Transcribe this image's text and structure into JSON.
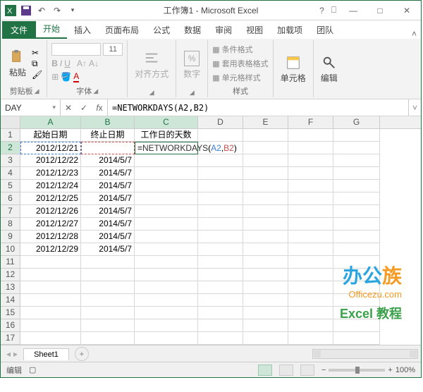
{
  "title": "工作簿1 - Microsoft Excel",
  "tabs": {
    "file": "文件",
    "home": "开始",
    "insert": "插入",
    "layout": "页面布局",
    "formulas": "公式",
    "data": "数据",
    "review": "审阅",
    "view": "视图",
    "addins": "加载项",
    "team": "团队"
  },
  "ribbon": {
    "clipboard": {
      "paste": "粘贴",
      "label": "剪贴板"
    },
    "font": {
      "label": "字体",
      "size": "11"
    },
    "align": {
      "label": "对齐方式"
    },
    "number": {
      "label": "数字",
      "percent": "%"
    },
    "styles": {
      "cond": "条件格式",
      "table": "套用表格格式",
      "cell": "单元格样式",
      "label": "样式"
    },
    "cells": {
      "label": "单元格"
    },
    "editing": {
      "label": "编辑"
    }
  },
  "formula_bar": {
    "name_box": "DAY",
    "formula": "=NETWORKDAYS(A2,B2)",
    "fn": "NETWORKDAYS",
    "a": "A2",
    "b": "B2"
  },
  "columns": [
    "A",
    "B",
    "C",
    "D",
    "E",
    "F",
    "G"
  ],
  "headers": {
    "A": "起始日期",
    "B": "终止日期",
    "C": "工作日的天数"
  },
  "rows": [
    {
      "n": 1
    },
    {
      "n": 2,
      "A": "2012/12/21",
      "B": "",
      "editing": true
    },
    {
      "n": 3,
      "A": "2012/12/22",
      "B": "2014/5/7"
    },
    {
      "n": 4,
      "A": "2012/12/23",
      "B": "2014/5/7"
    },
    {
      "n": 5,
      "A": "2012/12/24",
      "B": "2014/5/7"
    },
    {
      "n": 6,
      "A": "2012/12/25",
      "B": "2014/5/7"
    },
    {
      "n": 7,
      "A": "2012/12/26",
      "B": "2014/5/7"
    },
    {
      "n": 8,
      "A": "2012/12/27",
      "B": "2014/5/7"
    },
    {
      "n": 9,
      "A": "2012/12/28",
      "B": "2014/5/7"
    },
    {
      "n": 10,
      "A": "2012/12/29",
      "B": "2014/5/7"
    },
    {
      "n": 11
    },
    {
      "n": 12
    },
    {
      "n": 13
    },
    {
      "n": 14
    },
    {
      "n": 15
    },
    {
      "n": 16
    },
    {
      "n": 17
    }
  ],
  "sheet": {
    "name": "Sheet1"
  },
  "status": {
    "mode": "编辑",
    "zoom": "100%"
  },
  "watermark": {
    "brand1": "办公",
    "brand2": "族",
    "url": "Officezu.com",
    "sub": "Excel 教程"
  }
}
